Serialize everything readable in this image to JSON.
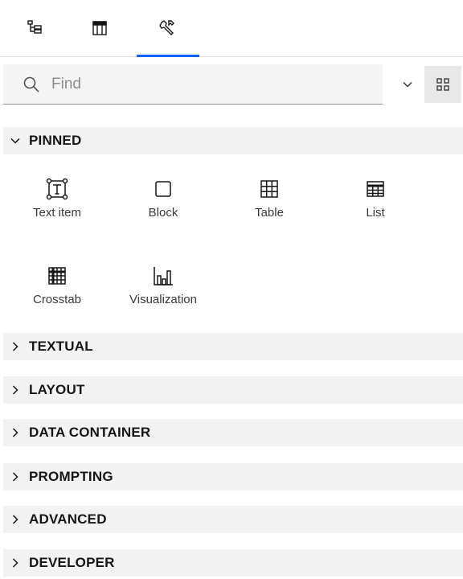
{
  "tabs": [
    {
      "icon": "tree-icon",
      "active": false
    },
    {
      "icon": "page-layout-icon",
      "active": false
    },
    {
      "icon": "wrench-icon",
      "active": true
    }
  ],
  "search": {
    "placeholder": "Find",
    "value": ""
  },
  "view_toggle_icon": "grid-view-icon",
  "dropdown_icon": "chevron-down-icon",
  "colors": {
    "accent": "#0f62fe",
    "section_bg": "#f2f2f2",
    "search_bg": "#f4f4f4"
  },
  "sections": {
    "pinned": {
      "label": "PINNED",
      "expanded": true,
      "items": [
        {
          "label": "Text item",
          "icon": "text-item-icon"
        },
        {
          "label": "Block",
          "icon": "block-icon"
        },
        {
          "label": "Table",
          "icon": "table-icon"
        },
        {
          "label": "List",
          "icon": "list-icon"
        },
        {
          "label": "Crosstab",
          "icon": "crosstab-icon"
        },
        {
          "label": "Visualization",
          "icon": "visualization-icon"
        }
      ]
    },
    "textual": {
      "label": "TEXTUAL",
      "expanded": false
    },
    "layout": {
      "label": "LAYOUT",
      "expanded": false
    },
    "data_container": {
      "label": "DATA CONTAINER",
      "expanded": false
    },
    "prompting": {
      "label": "PROMPTING",
      "expanded": false
    },
    "advanced": {
      "label": "ADVANCED",
      "expanded": false
    },
    "developer": {
      "label": "DEVELOPER",
      "expanded": false
    }
  }
}
